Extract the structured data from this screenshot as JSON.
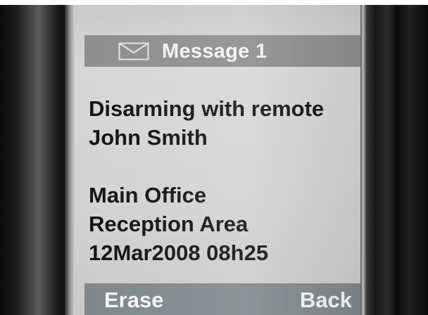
{
  "header": {
    "icon": "envelope-icon",
    "title": "Message 1"
  },
  "message": {
    "line1": "Disarming with remote",
    "line2": "John Smith",
    "line3": "Main Office",
    "line4": "Reception Area",
    "line5": "12Mar2008 08h25"
  },
  "softkeys": {
    "left": "Erase",
    "right": "Back"
  },
  "colors": {
    "screen": "#d3d3d3",
    "header_bar": "#8d8d8d",
    "softkey_bar": "#7e878a",
    "text": "#111111"
  }
}
